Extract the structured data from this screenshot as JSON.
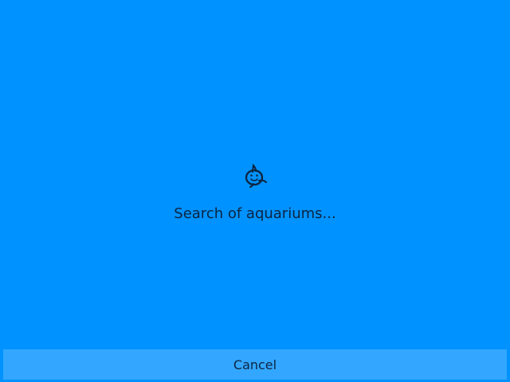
{
  "loading": {
    "icon": "fish-icon",
    "message": "Search of aquariums..."
  },
  "actions": {
    "cancel_label": "Cancel"
  },
  "colors": {
    "background": "#0092ff",
    "button_background": "#33a7ff",
    "text": "#0d2440"
  }
}
